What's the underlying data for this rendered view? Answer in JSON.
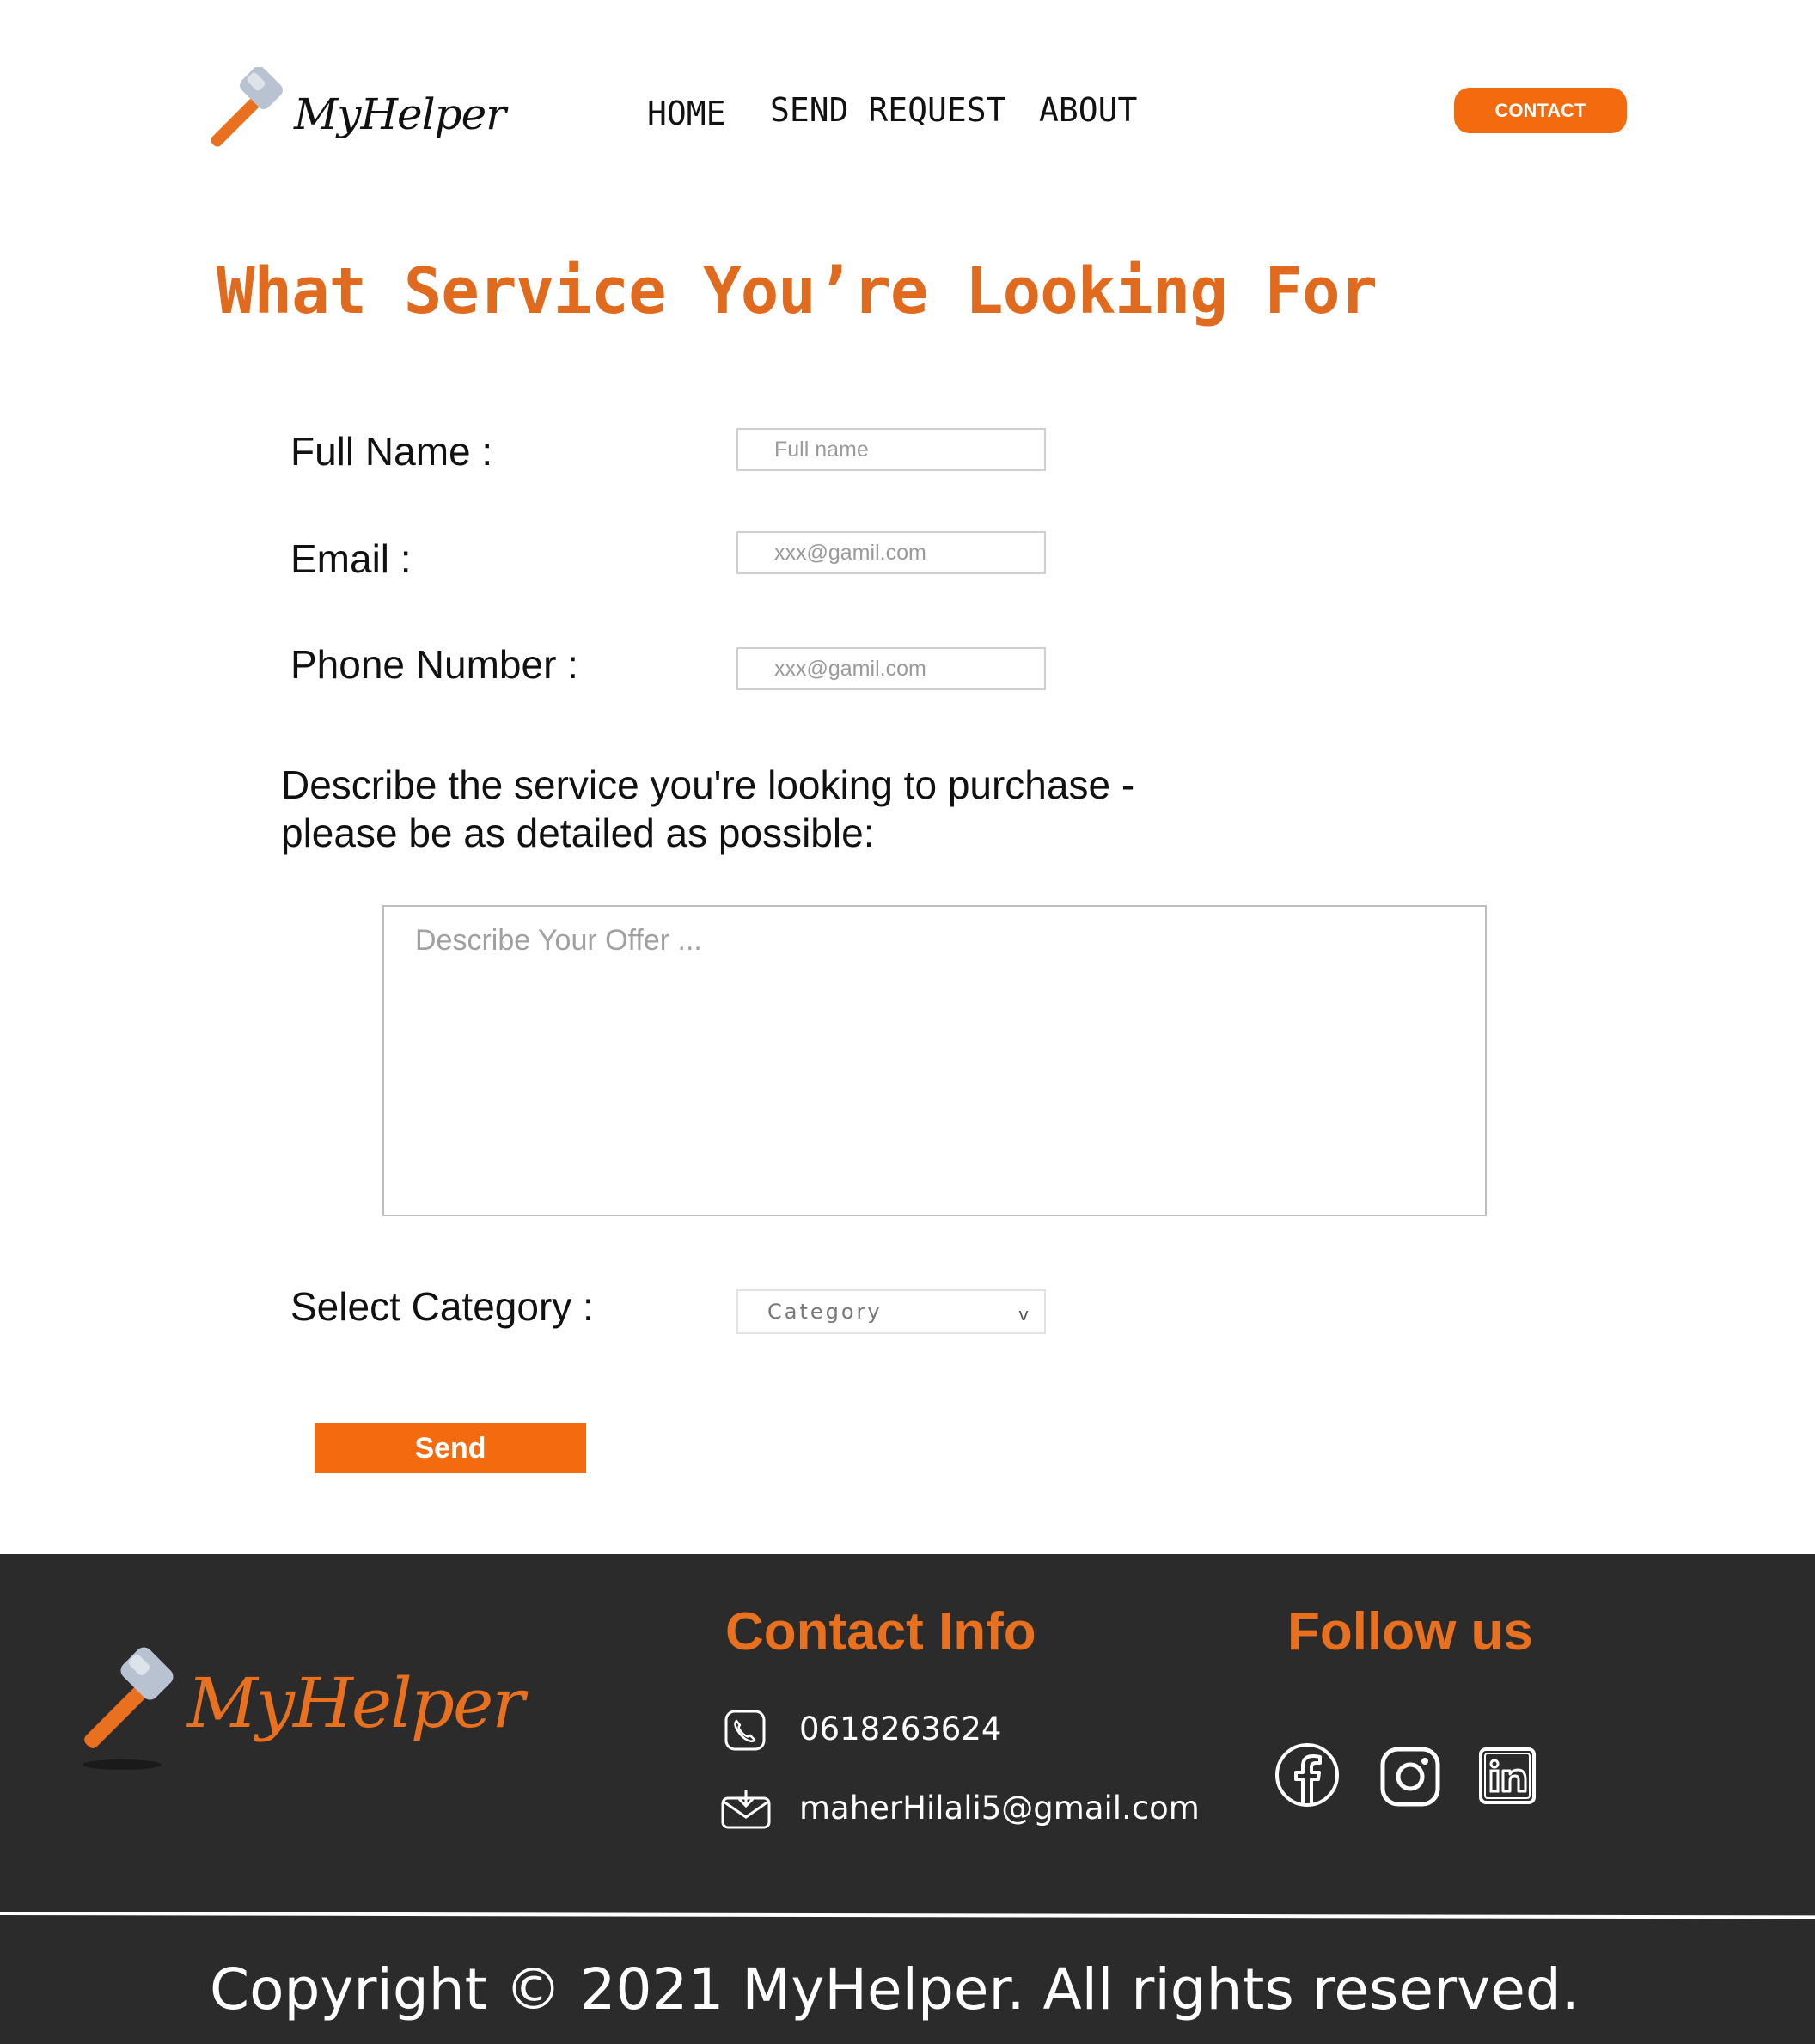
{
  "header": {
    "brand": "MyHelper",
    "nav": {
      "home": "HOME",
      "send_request": "SEND REQUEST",
      "about": "ABOUT"
    },
    "contact_button": "CONTACT"
  },
  "main": {
    "title": "What Service You’re Looking For",
    "form": {
      "full_name_label": "Full Name :",
      "full_name_placeholder": "Full name",
      "email_label": "Email :",
      "email_placeholder": "xxx@gamil.com",
      "phone_label": "Phone Number :",
      "phone_placeholder": "xxx@gamil.com",
      "describe_line1": "Describe the service you're looking to purchase -",
      "describe_line2": "please be as detailed as possible:",
      "describe_placeholder": "Describe Your Offer ...",
      "category_label": "Select Category :",
      "category_value": "Category",
      "send_button": "Send"
    }
  },
  "footer": {
    "brand": "MyHelper",
    "contact_heading": "Contact Info",
    "phone": "0618263624",
    "email": "maherHilali5@gmail.com",
    "follow_heading": "Follow us",
    "social_icons": [
      "facebook-icon",
      "instagram-icon",
      "linkedin-icon"
    ],
    "copyright": "Copyright © 2021 MyHelper. All rights reserved."
  },
  "colors": {
    "accent": "#f46a0f",
    "title": "#e06a1e",
    "footer_bg": "#2b2b2b"
  }
}
